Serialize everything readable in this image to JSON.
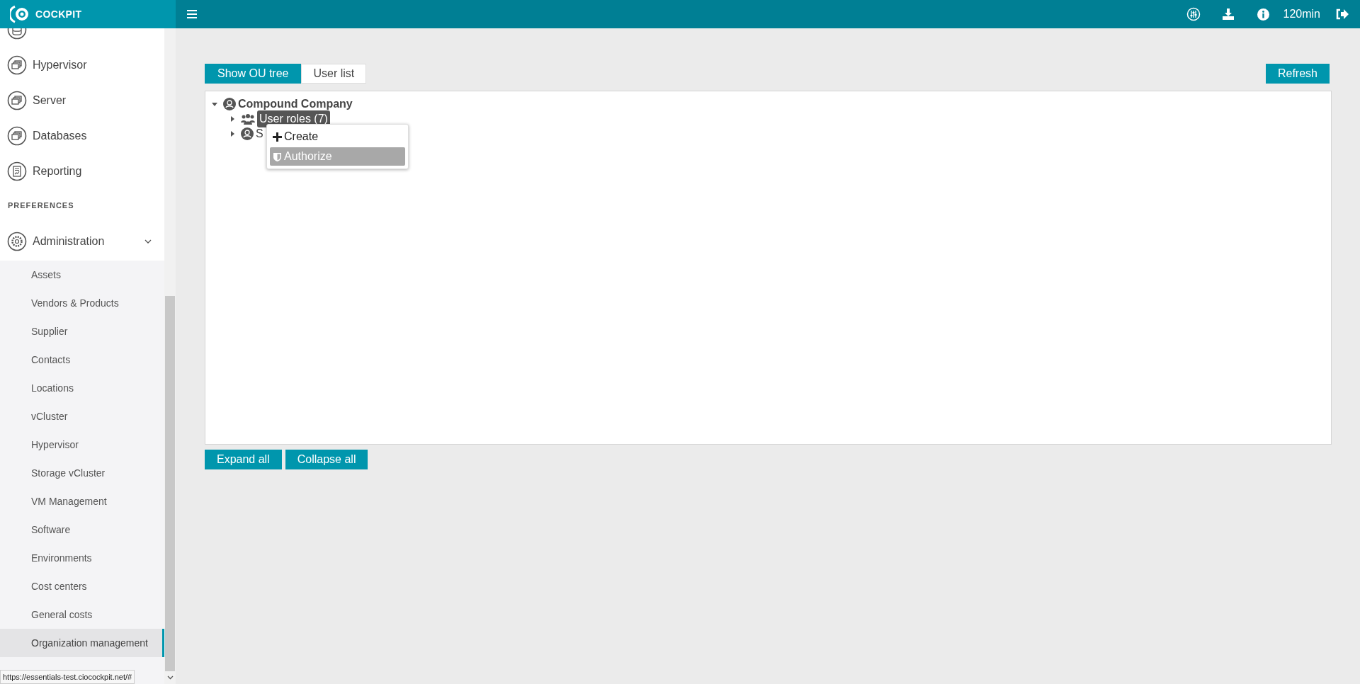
{
  "header": {
    "logo": "COCKPIT",
    "session": "120min"
  },
  "sidebar": {
    "items": [
      {
        "label": "Hypervisor",
        "kind": "stack"
      },
      {
        "label": "Server",
        "kind": "stack"
      },
      {
        "label": "Databases",
        "kind": "stack"
      },
      {
        "label": "Reporting",
        "kind": "report"
      }
    ],
    "section": "PREFERENCES",
    "admin": {
      "label": "Administration",
      "expanded": true,
      "children": [
        {
          "label": "Assets",
          "selected": false
        },
        {
          "label": "Vendors & Products",
          "selected": false
        },
        {
          "label": "Supplier",
          "selected": false
        },
        {
          "label": "Contacts",
          "selected": false
        },
        {
          "label": "Locations",
          "selected": false
        },
        {
          "label": "vCluster",
          "selected": false
        },
        {
          "label": "Hypervisor",
          "selected": false
        },
        {
          "label": "Storage vCluster",
          "selected": false
        },
        {
          "label": "VM Management",
          "selected": false
        },
        {
          "label": "Software",
          "selected": false
        },
        {
          "label": "Environments",
          "selected": false
        },
        {
          "label": "Cost centers",
          "selected": false
        },
        {
          "label": "General costs",
          "selected": false
        },
        {
          "label": "Organization management",
          "selected": true
        }
      ]
    }
  },
  "tabs": [
    {
      "label": "Show OU tree",
      "selected": true
    },
    {
      "label": "User list",
      "selected": false
    }
  ],
  "refresh": "Refresh",
  "tree": [
    {
      "label": "Compound Company",
      "kind": "company",
      "expanded": true,
      "selected": false,
      "children": [
        {
          "label": "User roles (7)",
          "kind": "roles",
          "expanded": false,
          "selected": true
        },
        {
          "label": "S",
          "kind": "company",
          "expanded": false,
          "selected": false
        }
      ]
    }
  ],
  "context_menu": [
    {
      "label": "Create",
      "kind": "create",
      "selected": false
    },
    {
      "label": "Authorize",
      "kind": "authorize",
      "selected": true
    }
  ],
  "buttons": [
    "Expand all",
    "Collapse all"
  ],
  "status_url": "https://essentials-test.ciocockpit.net/#"
}
